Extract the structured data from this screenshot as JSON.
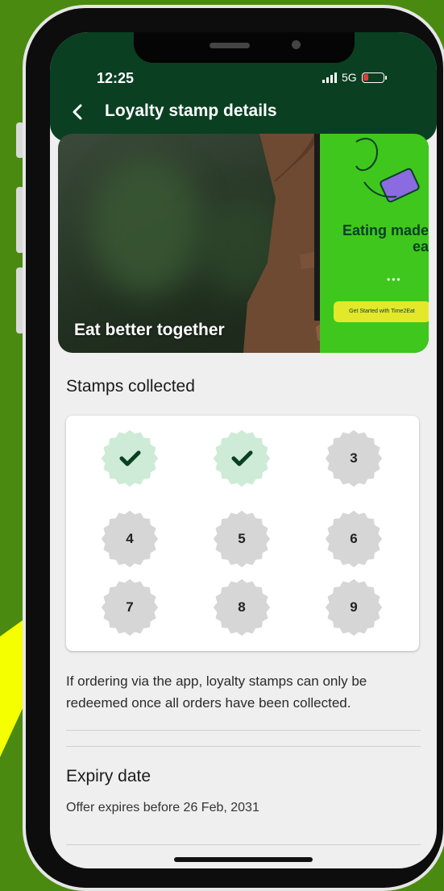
{
  "status_bar": {
    "time": "12:25",
    "network": "5G"
  },
  "header": {
    "title": "Loyalty stamp details",
    "back_icon": "chevron-left-icon"
  },
  "hero": {
    "caption": "Eat better together",
    "phone_text": "Eating made ea",
    "phone_button": "Get Started with Time2Eat"
  },
  "stamps": {
    "heading": "Stamps collected",
    "items": [
      {
        "label": "",
        "collected": true
      },
      {
        "label": "",
        "collected": true
      },
      {
        "label": "3",
        "collected": false
      },
      {
        "label": "4",
        "collected": false
      },
      {
        "label": "5",
        "collected": false
      },
      {
        "label": "6",
        "collected": false
      },
      {
        "label": "7",
        "collected": false
      },
      {
        "label": "8",
        "collected": false
      },
      {
        "label": "9",
        "collected": false
      }
    ],
    "note": "If ordering via the app, loyalty stamps can only be redeemed once all orders have been collected."
  },
  "expiry": {
    "heading": "Expiry date",
    "text": "Offer expires before 26 Feb, 2031"
  },
  "colors": {
    "background": "#4b8a10",
    "appbar": "#0a3f22",
    "collected_fill": "#cdebd6",
    "uncollected_fill": "#d6d6d6",
    "highlight": "#f5ff00"
  }
}
